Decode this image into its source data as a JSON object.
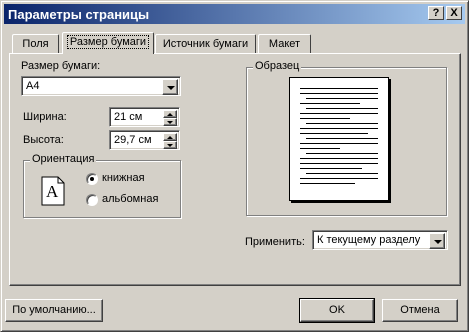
{
  "window": {
    "title": "Параметры страницы",
    "help_button": "?",
    "close_button": "X"
  },
  "tabs": [
    {
      "label": "Поля",
      "active": false
    },
    {
      "label": "Размер бумаги",
      "active": true
    },
    {
      "label": "Источник бумаги",
      "active": false
    },
    {
      "label": "Макет",
      "active": false
    }
  ],
  "paper_size": {
    "label": "Размер бумаги:",
    "value": "A4"
  },
  "width": {
    "label": "Ширина:",
    "value": "21 см"
  },
  "height": {
    "label": "Высота:",
    "value": "29,7 см"
  },
  "orientation": {
    "label": "Ориентация",
    "icon_letter": "A",
    "portrait_label": "книжная",
    "landscape_label": "альбомная",
    "selected": "portrait"
  },
  "preview": {
    "label": "Образец"
  },
  "apply": {
    "label": "Применить:",
    "value": "К текущему разделу"
  },
  "buttons": {
    "default_label": "По умолчанию...",
    "ok_label": "OK",
    "cancel_label": "Отмена"
  }
}
